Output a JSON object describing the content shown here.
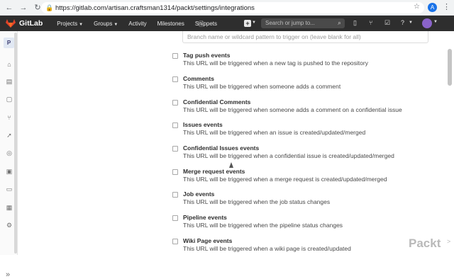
{
  "browser": {
    "url": "https://gitlab.com/artisan.craftsman1314/packt/settings/integrations",
    "profile_initial": "A"
  },
  "header": {
    "brand": "GitLab",
    "nav": [
      {
        "label": "Projects",
        "dropdown": true
      },
      {
        "label": "Groups",
        "dropdown": true
      },
      {
        "label": "Activity",
        "dropdown": false
      },
      {
        "label": "Milestones",
        "dropdown": false
      },
      {
        "label": "Snippets",
        "dropdown": false
      }
    ],
    "search_placeholder": "Search or jump to..."
  },
  "sidebar": {
    "project_badge": "P",
    "icons": [
      "home-icon",
      "repository-icon",
      "issues-icon",
      "merge-requests-icon",
      "ci-cd-icon",
      "operations-icon",
      "registry-icon",
      "wiki-icon",
      "snippets-icon",
      "settings-icon"
    ]
  },
  "branch_filter": {
    "placeholder": "Branch name or wildcard pattern to trigger on (leave blank for all)"
  },
  "events": [
    {
      "title": "Tag push events",
      "desc": "This URL will be triggered when a new tag is pushed to the repository"
    },
    {
      "title": "Comments",
      "desc": "This URL will be triggered when someone adds a comment"
    },
    {
      "title": "Confidential Comments",
      "desc": "This URL will be triggered when someone adds a comment on a confidential issue"
    },
    {
      "title": "Issues events",
      "desc": "This URL will be triggered when an issue is created/updated/merged"
    },
    {
      "title": "Confidential Issues events",
      "desc": "This URL will be triggered when a confidential issue is created/updated/merged"
    },
    {
      "title": "Merge request events",
      "desc": "This URL will be triggered when a merge request is created/updated/merged"
    },
    {
      "title": "Job events",
      "desc": "This URL will be triggered when the job status changes"
    },
    {
      "title": "Pipeline events",
      "desc": "This URL will be triggered when the pipeline status changes"
    },
    {
      "title": "Wiki Page events",
      "desc": "This URL will be triggered when a wiki page is created/updated"
    }
  ],
  "watermark": {
    "text": "Packt",
    "sup": ">"
  },
  "colors": {
    "header_bg": "#2e2e2e",
    "logo_orange": "#e24329",
    "avatar": "#8a63c9"
  }
}
